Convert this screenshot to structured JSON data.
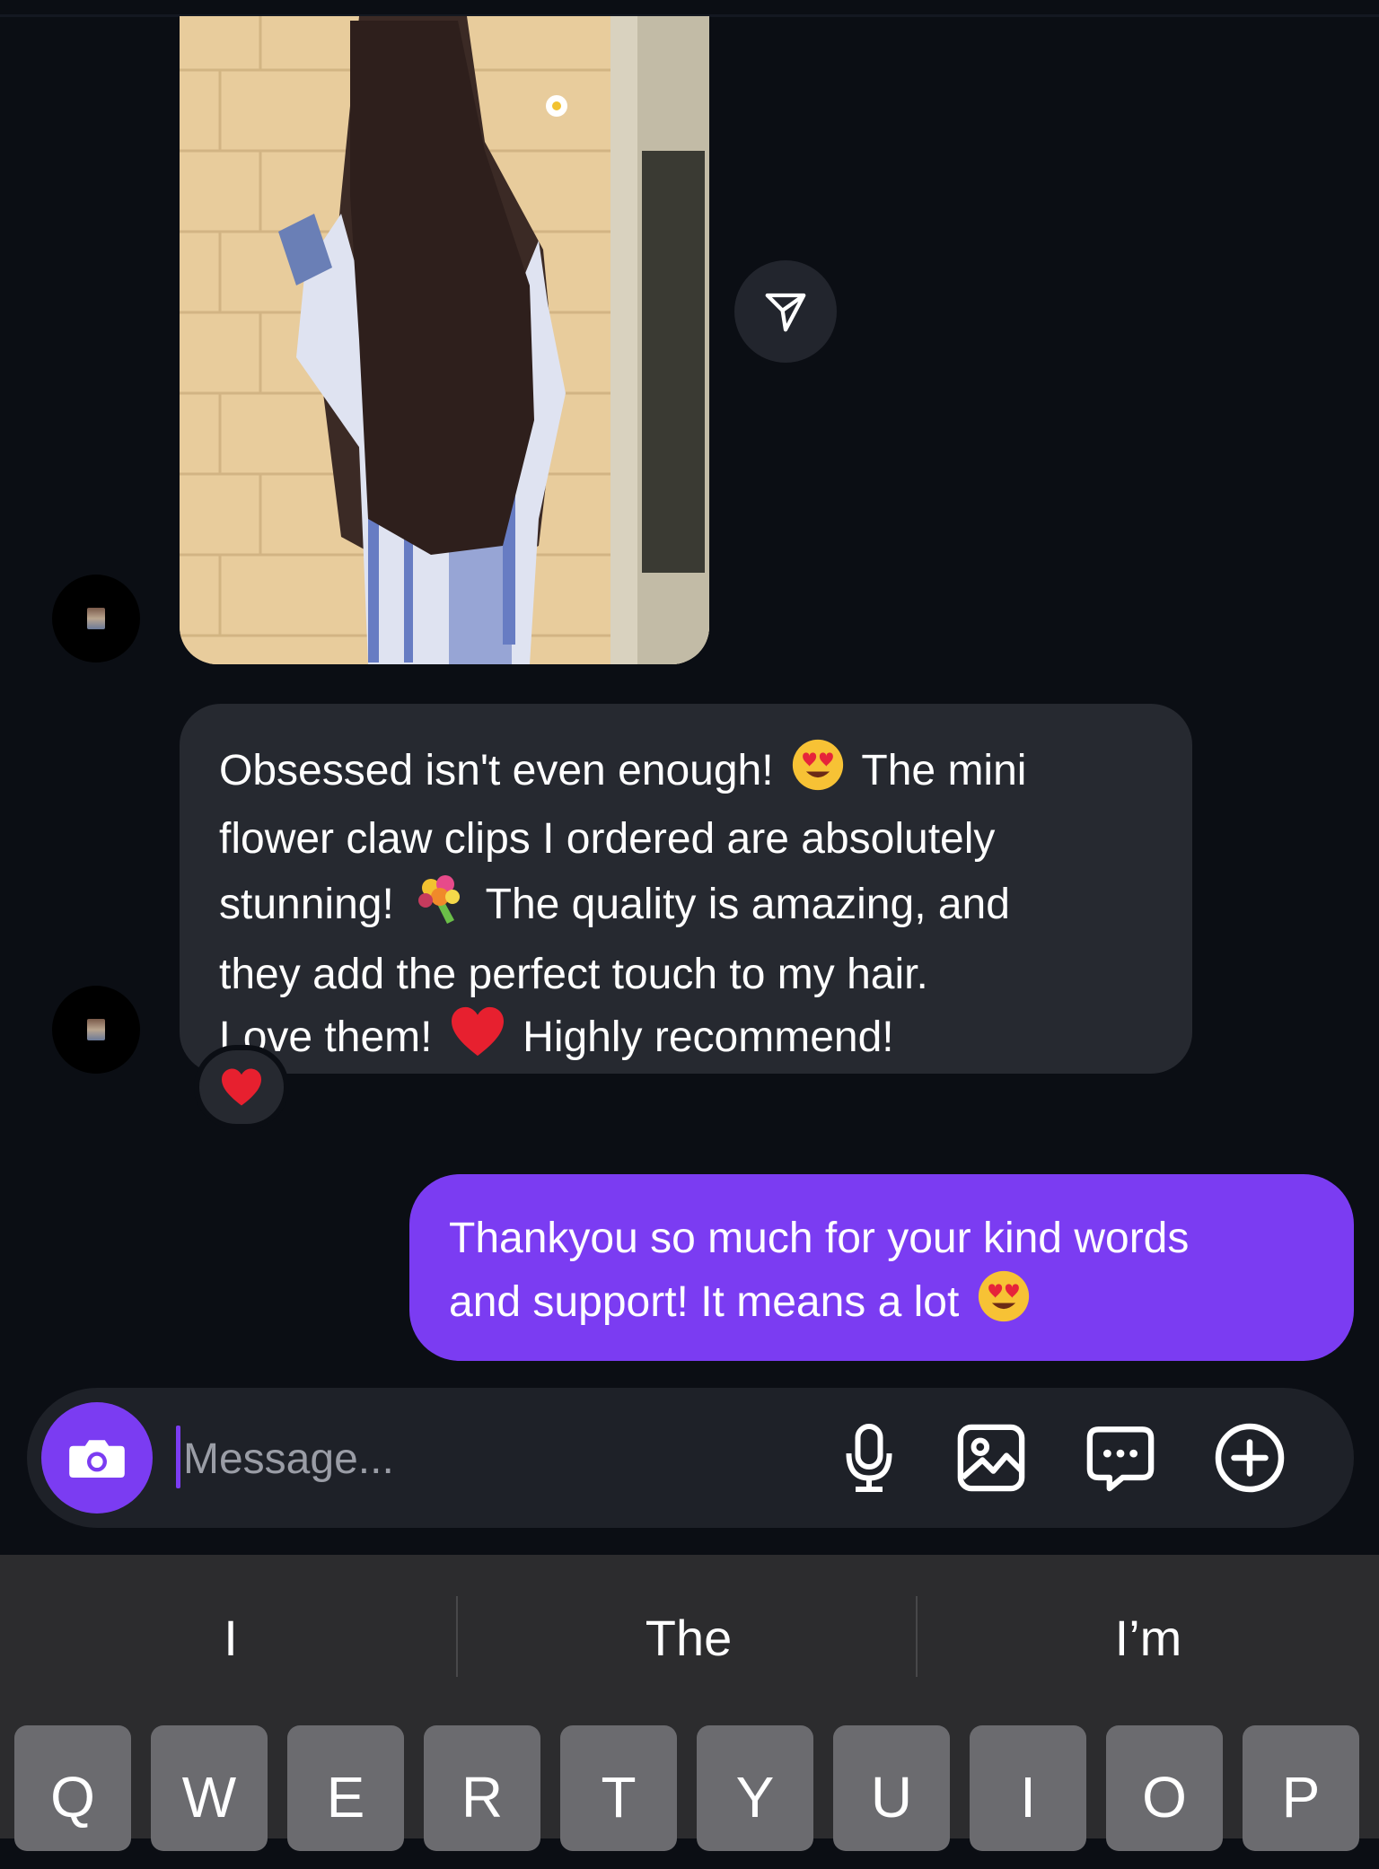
{
  "incoming_message": {
    "lines": [
      [
        "Obsessed isn't even enough! ",
        " The mini"
      ],
      [
        "flower claw clips I ordered are absolutely"
      ],
      [
        "stunning! ",
        " The quality is amazing, and"
      ],
      [
        "they add the perfect touch to my hair."
      ],
      [
        "Love them! ",
        " Highly recommend!"
      ]
    ],
    "reaction": "heart"
  },
  "outgoing_message": {
    "lines": [
      [
        "Thankyou so much for your kind words"
      ],
      [
        "and support! It means a lot "
      ]
    ]
  },
  "composer": {
    "placeholder": "Message...",
    "icons": [
      "camera-icon",
      "microphone-icon",
      "gallery-icon",
      "sticker-chat-icon",
      "add-icon"
    ]
  },
  "keyboard": {
    "suggestions": [
      "I",
      "The",
      "I’m"
    ],
    "top_row": [
      "Q",
      "W",
      "E",
      "R",
      "T",
      "Y",
      "U",
      "I",
      "O",
      "P"
    ]
  },
  "colors": {
    "background": "#0b0e14",
    "incoming_bubble": "#262930",
    "outgoing_bubble": "#7b3cf2",
    "accent": "#7b3cf2",
    "keyboard": "#2c2c2e",
    "key": "#6b6b6f"
  }
}
